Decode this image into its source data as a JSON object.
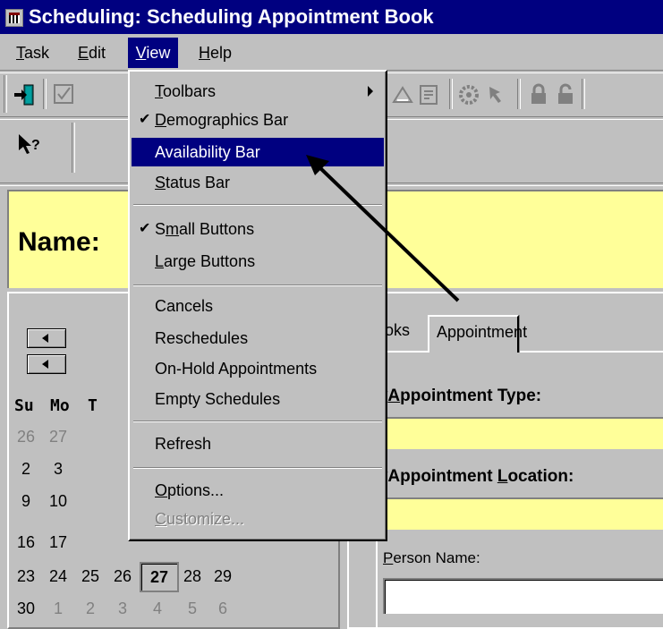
{
  "window": {
    "title": "Scheduling: Scheduling Appointment Book"
  },
  "menubar": {
    "items": [
      {
        "pre": "",
        "acc": "T",
        "post": "ask"
      },
      {
        "pre": "",
        "acc": "E",
        "post": "dit"
      },
      {
        "pre": "",
        "acc": "V",
        "post": "iew"
      },
      {
        "pre": "",
        "acc": "H",
        "post": "elp"
      }
    ]
  },
  "view_menu": {
    "items": [
      {
        "pre": "",
        "acc": "T",
        "post": "oolbars",
        "checked": false,
        "submenu": true
      },
      {
        "pre": "",
        "acc": "D",
        "post": "emographics Bar",
        "checked": true
      },
      {
        "pre": "",
        "acc": "",
        "post": "Availability Bar",
        "checked": false,
        "highlighted": true
      },
      {
        "pre": "",
        "acc": "S",
        "post": "tatus Bar",
        "checked": false
      },
      {
        "pre": "S",
        "acc": "m",
        "post": "all Buttons",
        "checked": true
      },
      {
        "pre": "",
        "acc": "L",
        "post": "arge Buttons",
        "checked": false
      },
      {
        "pre": "",
        "acc": "",
        "post": "Cancels"
      },
      {
        "pre": "",
        "acc": "",
        "post": "Reschedules"
      },
      {
        "pre": "",
        "acc": "",
        "post": "On-Hold Appointments"
      },
      {
        "pre": "",
        "acc": "",
        "post": "Empty Schedules"
      },
      {
        "pre": "",
        "acc": "",
        "post": "Refresh"
      },
      {
        "pre": "",
        "acc": "O",
        "post": "ptions..."
      },
      {
        "pre": "",
        "acc": "C",
        "post": "ustomize...",
        "disabled": true
      }
    ]
  },
  "demographics": {
    "name_label": "Name:"
  },
  "calendar": {
    "weekday_headers": [
      "Su",
      "Mo",
      "T"
    ],
    "rows": [
      [
        "26",
        "27"
      ],
      [
        "2",
        "3"
      ],
      [
        "9",
        "10"
      ],
      [
        "16",
        "17"
      ],
      [
        "23",
        "24",
        "25",
        "26",
        "27",
        "28",
        "29"
      ],
      [
        "30",
        "1",
        "2",
        "3",
        "4",
        "5",
        "6"
      ]
    ],
    "today": "27"
  },
  "tabs": {
    "books_partial": "oks",
    "appointment": "Appointment"
  },
  "form": {
    "appt_type_label_prefix": "*",
    "appt_type_label_acc": "A",
    "appt_type_label_rest": "ppointment Type:",
    "appt_location_label_prefix": "*Appointment ",
    "appt_location_label_acc": "L",
    "appt_location_label_rest": "ocation:",
    "person_name_label_acc": "P",
    "person_name_label_rest": "erson Name:"
  },
  "colors": {
    "titlebar": "#000080",
    "highlight": "#000080",
    "field_yellow": "#ffff99",
    "chrome": "#c0c0c0"
  },
  "icons": [
    "exit-icon",
    "checkbox-icon",
    "help-pointer-icon",
    "lock-icon",
    "unlock-icon"
  ]
}
